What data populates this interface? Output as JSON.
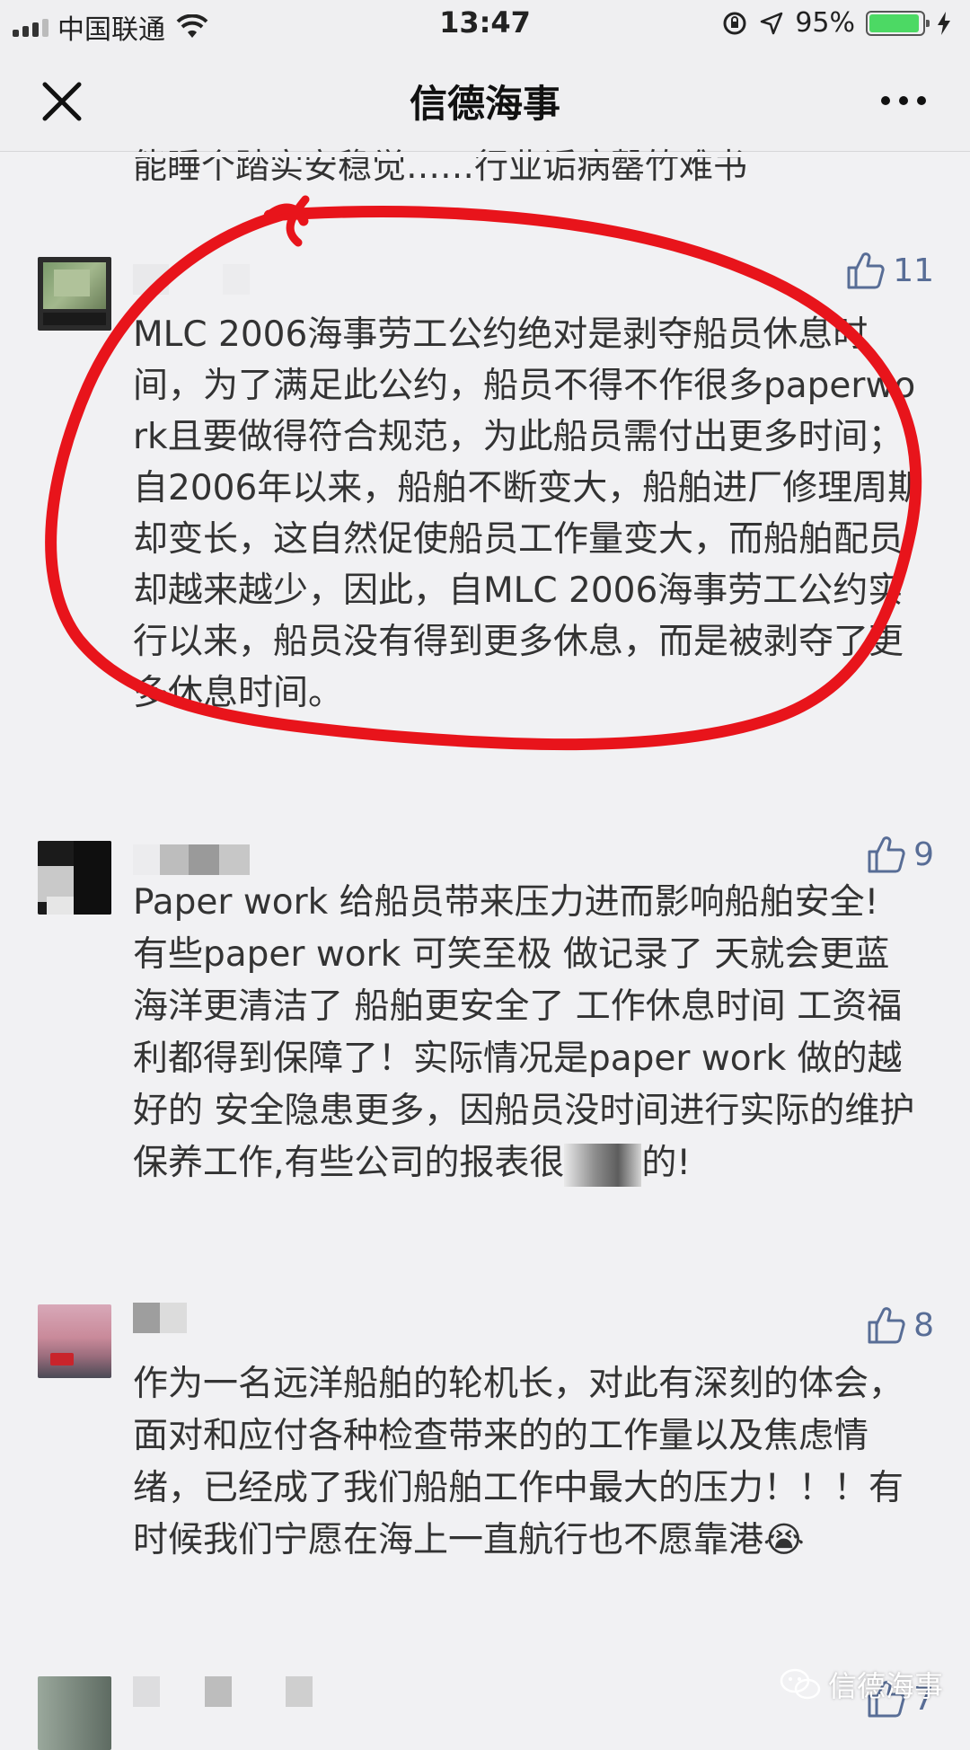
{
  "status_bar": {
    "carrier": "中国联通",
    "time": "13:47",
    "battery_percent_text": "95%",
    "battery_level": 0.95,
    "signal_icon": "signal-icon",
    "wifi_icon": "wifi-icon",
    "location_icon": "location-arrow-icon",
    "lock_icon": "rotation-lock-icon",
    "charging_icon": "charging-bolt-icon"
  },
  "nav": {
    "title": "信德海事",
    "close_icon": "close-icon",
    "more_icon": "more-icon"
  },
  "cut_line_text": "能睡个踏实安稳觉……行业诟病罄竹难书",
  "comments": [
    {
      "likes": "11",
      "text": "MLC 2006海事劳工公约绝对是剥夺船员休息时间，为了满足此公约，船员不得不作很多paperwork且要做得符合规范，为此船员需付出更多时间；自2006年以来，船舶不断变大，船舶进厂修理周期却变长，这自然促使船员工作量变大，而船舶配员却越来越少，因此，自MLC 2006海事劳工公约实行以来，船员没有得到更多休息，而是被剥夺了更多休息时间。"
    },
    {
      "likes": "9",
      "text_before": "Paper work 给船员带来压力进而影响船舶安全! 有些paper work 可笑至极  做记录了 天就会更蓝 海洋更清洁了 船舶更安全了 工作休息时间 工资福利都得到保障了！实际情况是paper work 做的越好的 安全隐患更多，因船员没时间进行实际的维护保养工作,有些公司的报表很",
      "text_after": "的!"
    },
    {
      "likes": "8",
      "text": "作为一名远洋船舶的轮机长，对此有深刻的体会，面对和应付各种检查带来的的工作量以及焦虑情绪，已经成了我们船舶工作中最大的压力！！！有时候我们宁愿在海上一直航行也不愿靠港",
      "emoji": "😭"
    },
    {
      "likes": "7"
    }
  ],
  "watermark": {
    "text": "信德海事",
    "icon": "wechat-icon"
  },
  "colors": {
    "background": "#f1f1f3",
    "like_blue": "#586d96",
    "annotation_red": "#e8141b"
  }
}
